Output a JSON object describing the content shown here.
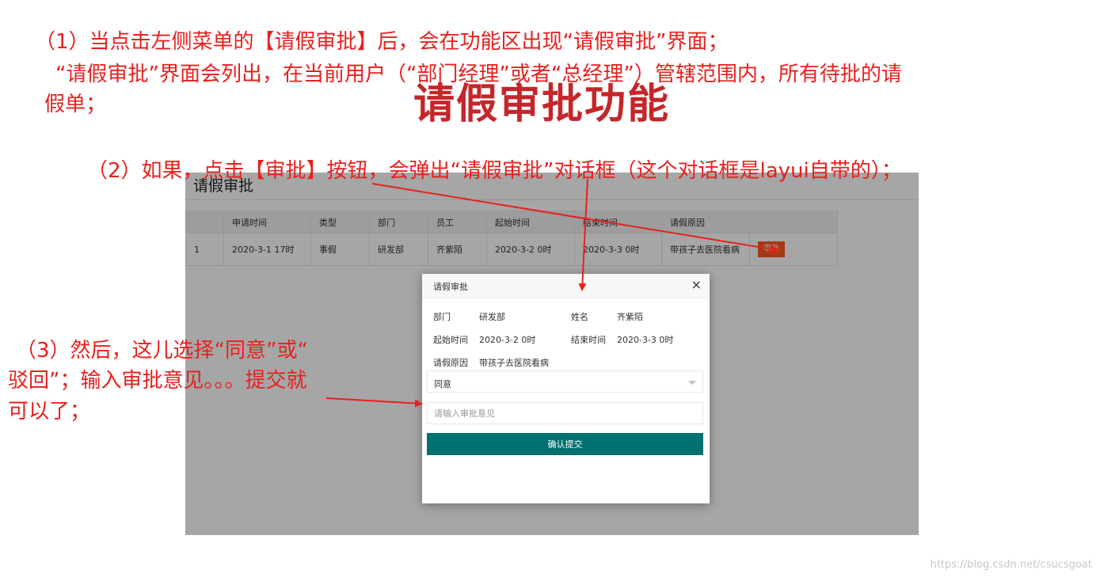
{
  "annotations": {
    "step1_line1": "（1）当点击左侧菜单的【请假审批】后，会在功能区出现“请假审批”界面；",
    "step1_line2": "“请假审批”界面会列出，在当前用户（“部门经理”或者“总经理”）管辖范围内，所有待批的请",
    "step1_line3": "假单；",
    "big_title": "请假审批功能",
    "step2": "（2）如果，点击【审批】按钮，会弹出“请假审批”对话框（这个对话框是layui自带的）；",
    "step3_line1": "（3）然后，这儿选择“同意”或“",
    "step3_line2": "驳回”；输入审批意见。。。提交就",
    "step3_line3": "可以了；"
  },
  "page": {
    "title": "请假审批",
    "columns": [
      "",
      "申请时间",
      "类型",
      "部门",
      "员工",
      "起始时间",
      "结束时间",
      "请假原因",
      ""
    ],
    "rows": [
      {
        "index": "1",
        "apply_time": "2020-3-1 17时",
        "type": "事假",
        "dept": "研发部",
        "employee": "齐紫陌",
        "start": "2020-3-2 0时",
        "end": "2020-3-3 0时",
        "reason": "带孩子去医院看病",
        "action": "审批"
      }
    ]
  },
  "dialog": {
    "title": "请假审批",
    "close": "×",
    "dept_label": "部门",
    "dept_value": "研发部",
    "name_label": "姓名",
    "name_value": "齐紫陌",
    "start_label": "起始时间",
    "start_value": "2020-3-2 0时",
    "end_label": "结束时间",
    "end_value": "2020-3-3 0时",
    "reason_label": "请假原因",
    "reason_value": "带孩子去医院看病",
    "decision_selected": "同意",
    "opinion_placeholder": "请输入审批意见",
    "submit_label": "确认提交"
  },
  "watermark": "https://blog.csdn.net/csucsgoat",
  "colors": {
    "annotation": "#e8201e",
    "title": "#c5262a",
    "approve_button": "#ff5722",
    "submit_button": "#007070"
  }
}
